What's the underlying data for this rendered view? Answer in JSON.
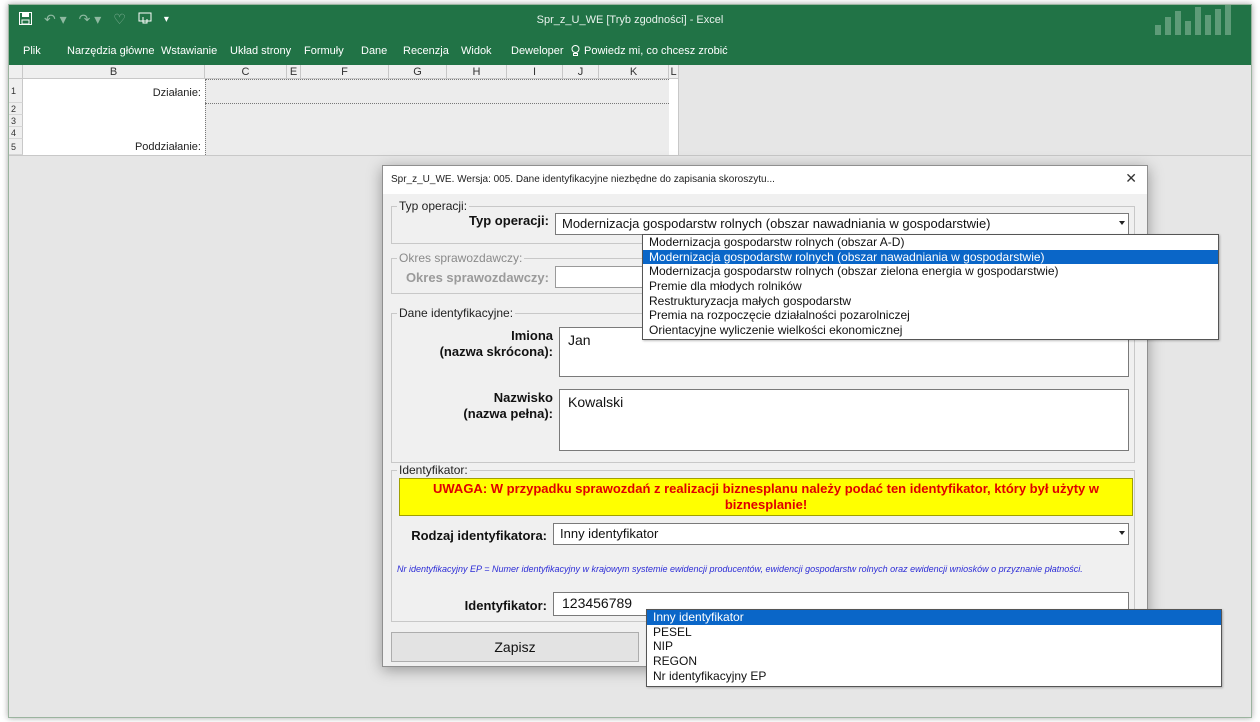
{
  "window": {
    "title": "Spr_z_U_WE [Tryb zgodności] - Excel",
    "qat": {
      "save": "save-icon",
      "undo": "undo-icon",
      "redo": "redo-icon",
      "extra": "qat-dropdown-icon"
    }
  },
  "ribbon": {
    "tabs": [
      "Plik",
      "Narzędzia główne",
      "Wstawianie",
      "Układ strony",
      "Formuły",
      "Dane",
      "Recenzja",
      "Widok",
      "Deweloper"
    ],
    "tell_me": "Powiedz mi, co chcesz zrobić"
  },
  "sheet": {
    "columns": [
      "B",
      "C",
      "E",
      "F",
      "G",
      "H",
      "I",
      "J",
      "K",
      "L"
    ],
    "rows": [
      "1",
      "2",
      "3",
      "4",
      "5"
    ],
    "labels": {
      "dzialanie": "Działanie:",
      "poddzialanie": "Poddziałanie:"
    }
  },
  "dialog": {
    "title": "Spr_z_U_WE. Wersja: 005. Dane identyfikacyjne niezbędne do zapisania skoroszytu...",
    "close": "✕",
    "typ_operacji": {
      "legend": "Typ operacji:",
      "label": "Typ operacji:",
      "value": "Modernizacja gospodarstw rolnych (obszar nawadniania w gospodarstwie)"
    },
    "okres": {
      "legend": "Okres sprawozdawczy:",
      "label": "Okres sprawozdawczy:",
      "value": ""
    },
    "dane": {
      "legend": "Dane identyfikacyjne:",
      "imiona_label_1": "Imiona",
      "imiona_label_2": "(nazwa skrócona):",
      "imiona_value": "Jan",
      "nazwisko_label_1": "Nazwisko",
      "nazwisko_label_2": "(nazwa pełna):",
      "nazwisko_value": "Kowalski"
    },
    "identyfikator": {
      "legend": "Identyfikator:",
      "warning": "UWAGA: W przypadku sprawozdań z realizacji biznesplanu należy podać ten identyfikator, który był użyty w biznesplanie!",
      "rodzaj_label": "Rodzaj identyfikatora:",
      "rodzaj_value": "Inny identyfikator",
      "note": "Nr identyfikacyjny EP = Numer identyfikacyjny w krajowym systemie ewidencji producentów, ewidencji gospodarstw rolnych oraz ewidencji wniosków o przyznanie płatności.",
      "id_label": "Identyfikator:",
      "id_value": "123456789"
    },
    "zapisz": "Zapisz"
  },
  "typ_dropdown": {
    "options": [
      "Modernizacja gospodarstw rolnych (obszar A-D)",
      "Modernizacja gospodarstw rolnych (obszar nawadniania w gospodarstwie)",
      "Modernizacja gospodarstw rolnych (obszar zielona energia w gospodarstwie)",
      "Premie dla młodych rolników",
      "Restrukturyzacja małych gospodarstw",
      "Premia na rozpoczęcie działalności pozarolniczej",
      "Orientacyjne wyliczenie wielkości ekonomicznej"
    ],
    "selected_index": 1
  },
  "rodzaj_dropdown": {
    "options": [
      "Inny identyfikator",
      "PESEL",
      "NIP",
      "REGON",
      "Nr identyfikacyjny EP"
    ],
    "selected_index": 0
  }
}
